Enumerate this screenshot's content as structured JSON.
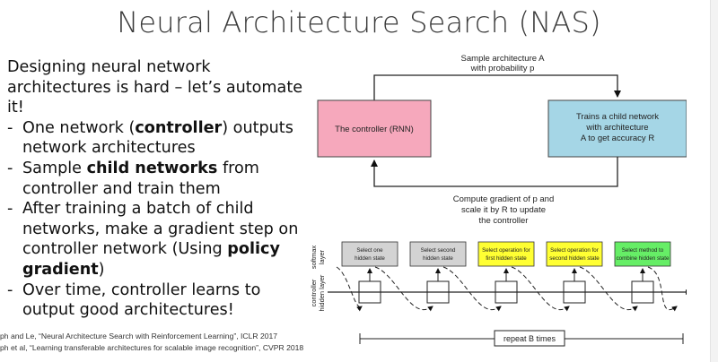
{
  "slide": {
    "title": "Neural Architecture Search (NAS)",
    "intro": "Designing neural network architectures is hard – let’s automate it!",
    "bullets": [
      {
        "parts": [
          {
            "t": "One network (",
            "b": false
          },
          {
            "t": "controller",
            "b": true
          },
          {
            "t": ") outputs network architectures",
            "b": false
          }
        ]
      },
      {
        "parts": [
          {
            "t": "Sample ",
            "b": false
          },
          {
            "t": "child networks",
            "b": true
          },
          {
            "t": " from controller and train them",
            "b": false
          }
        ]
      },
      {
        "parts": [
          {
            "t": "After training a batch of child networks, make a gradient step on controller network (Using ",
            "b": false
          },
          {
            "t": "policy gradient",
            "b": true
          },
          {
            "t": ")",
            "b": false
          }
        ]
      },
      {
        "parts": [
          {
            "t": "Over time, controller learns to output good architectures!",
            "b": false
          }
        ]
      }
    ],
    "references": [
      "ph and Le, “Neural Architecture Search with Reinforcement Learning”, ICLR 2017",
      "ph et al, “Learning transferable architectures for scalable image recognition”, CVPR 2018"
    ]
  },
  "diagram_top": {
    "sample_label_1": "Sample architecture A",
    "sample_label_2": "with probability p",
    "controller_label": "The controller (RNN)",
    "child_label_1": "Trains a child network",
    "child_label_2": "with architecture",
    "child_label_3": "A to get accuracy R",
    "gradient_label_1": "Compute gradient of p and",
    "gradient_label_2": "scale it by R to update",
    "gradient_label_3": "the controller",
    "controller_color": "#f6a8bc",
    "child_color": "#a5d6e6"
  },
  "diagram_bottom": {
    "softmax_label_1": "softmax",
    "softmax_label_2": "layer",
    "hidden_label_1": "controller",
    "hidden_label_2": "hidden layer",
    "steps": [
      {
        "line1": "Select one",
        "line2": "hidden state",
        "color": "#d3d3d3"
      },
      {
        "line1": "Select second",
        "line2": "hidden state",
        "color": "#d3d3d3"
      },
      {
        "line1": "Select operation for",
        "line2": "first hidden state",
        "color": "#ffff33"
      },
      {
        "line1": "Select operation for",
        "line2": "second hidden state",
        "color": "#ffff33"
      },
      {
        "line1": "Select method to",
        "line2": "combine hidden state",
        "color": "#66ee66"
      }
    ],
    "repeat_label": "repeat B times"
  }
}
